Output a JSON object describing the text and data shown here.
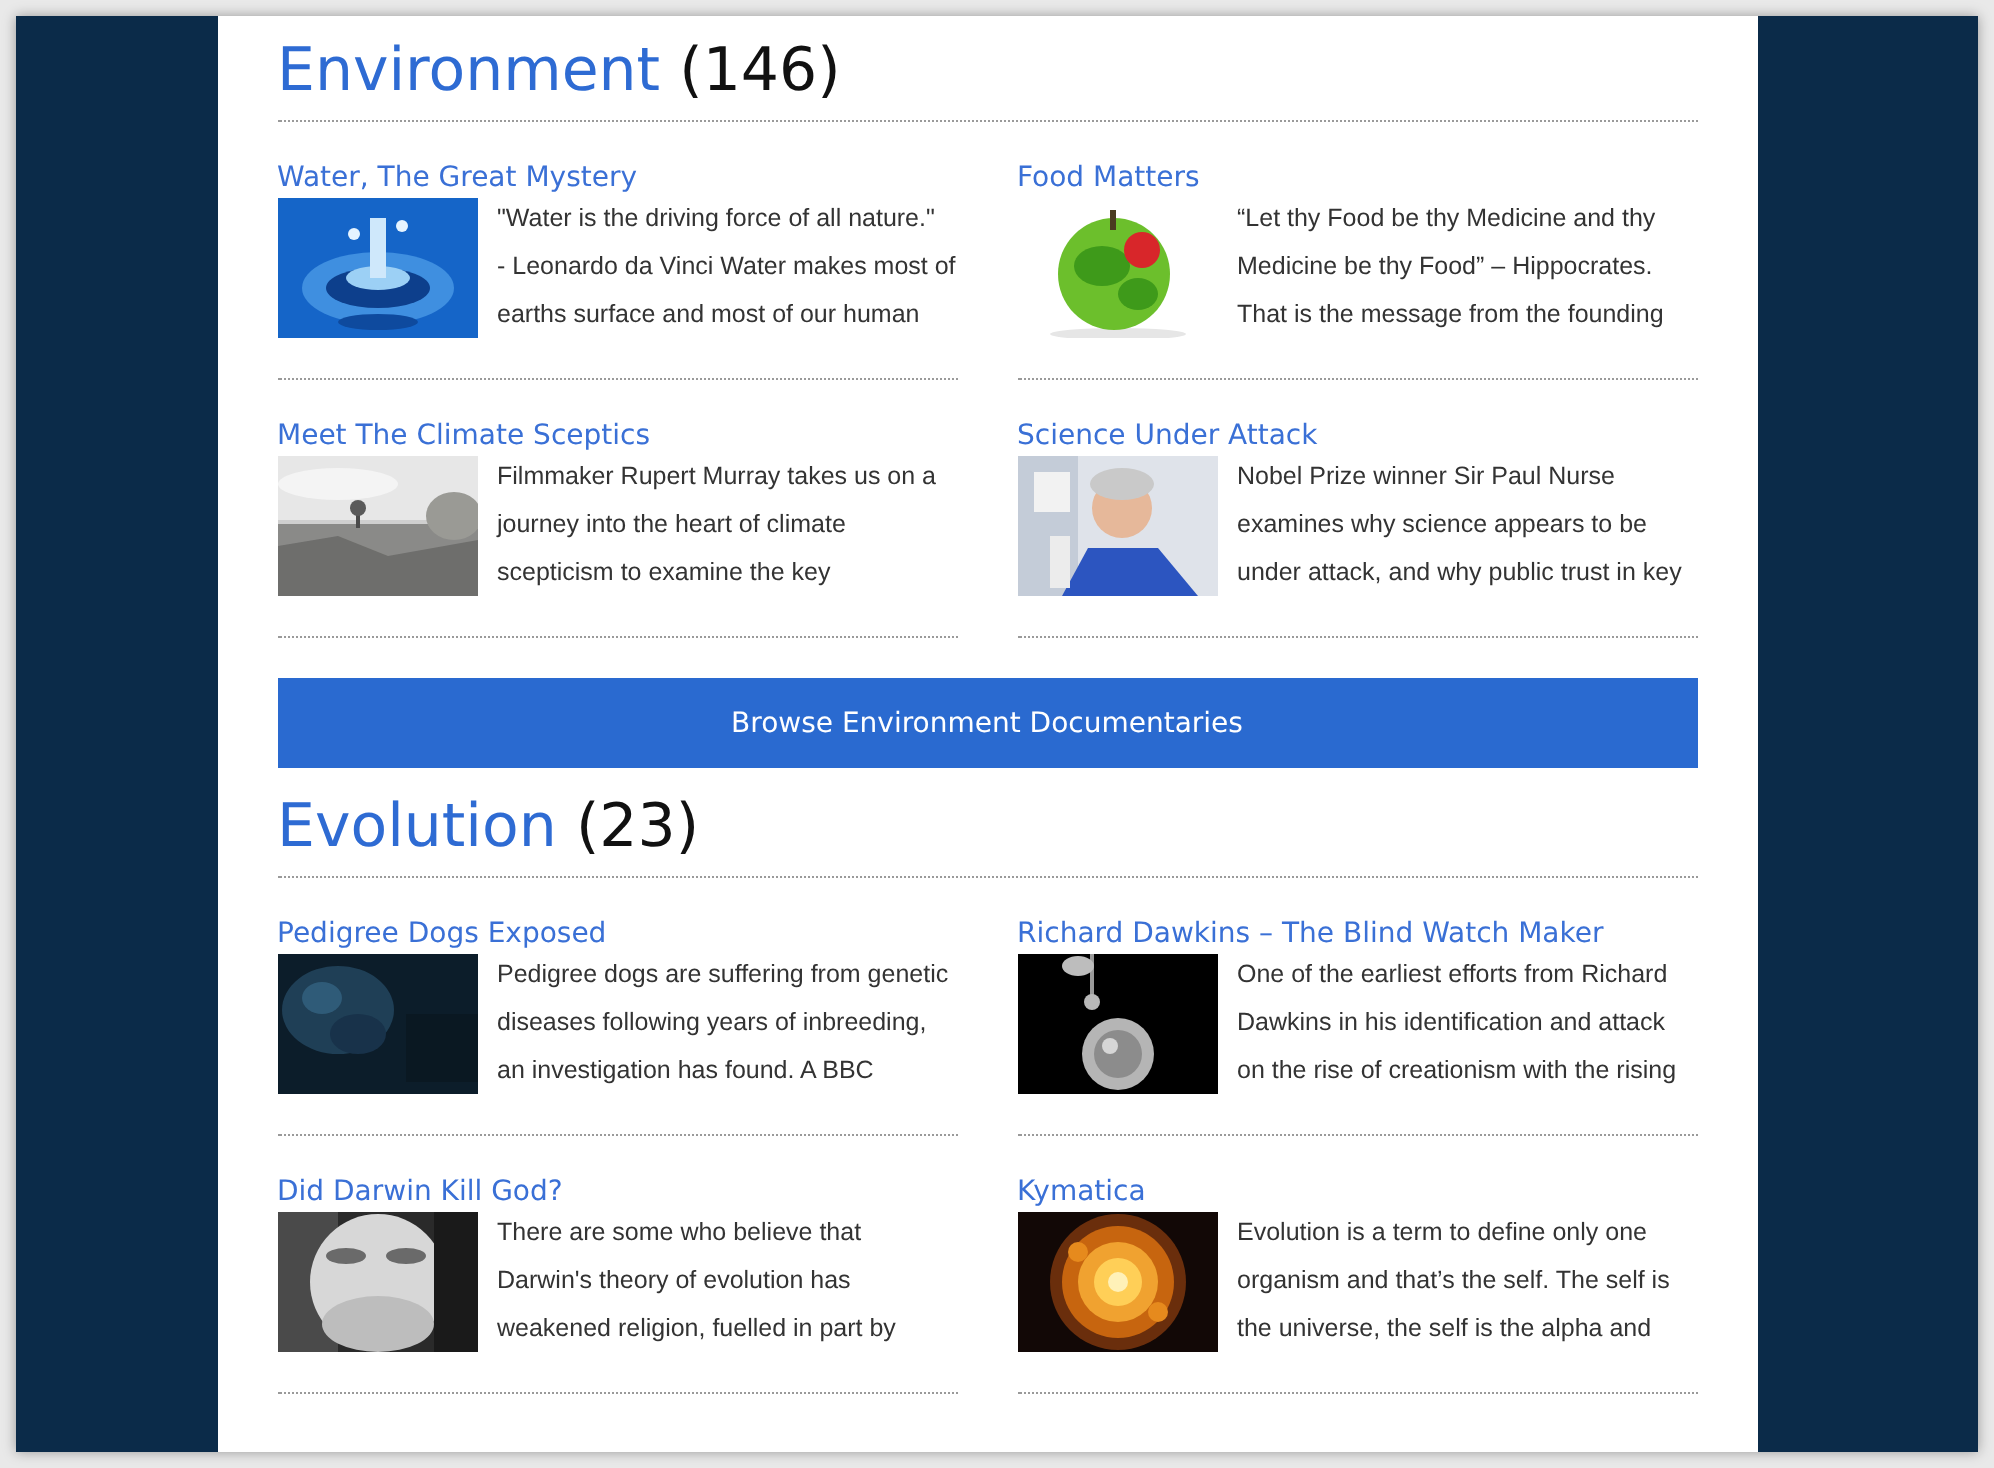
{
  "sections": [
    {
      "heading": "Environment",
      "count": "(146)",
      "items": [
        {
          "title": "Water, The Great Mystery",
          "lines": [
            "\"Water is the driving force of all nature.\"",
            "- Leonardo da Vinci Water makes most of",
            "earths surface and most of our human"
          ],
          "image": {
            "kind": "picture"
          }
        },
        {
          "title": "Food Matters",
          "lines": [
            "“Let thy Food be thy Medicine and thy",
            "Medicine be thy Food” – Hippocrates.",
            "That is the message from the founding"
          ],
          "image": {
            "kind": "picture"
          }
        },
        {
          "title": "Meet The Climate Sceptics",
          "lines": [
            "Filmmaker Rupert Murray takes us on a",
            "journey into the heart of climate",
            "scepticism to examine the key"
          ],
          "image": {
            "kind": "picture"
          }
        },
        {
          "title": "Science Under Attack",
          "lines": [
            "Nobel Prize winner Sir Paul Nurse",
            "examines why science appears to be",
            "under attack, and why public trust in key"
          ],
          "image": {
            "kind": "picture"
          }
        }
      ],
      "button": "Browse Environment Documentaries"
    },
    {
      "heading": "Evolution",
      "count": "(23)",
      "items": [
        {
          "title": "Pedigree Dogs Exposed",
          "lines": [
            "Pedigree dogs are suffering from genetic",
            "diseases following years of inbreeding,",
            "an investigation has found. A BBC"
          ],
          "image": {
            "kind": "picture"
          }
        },
        {
          "title": "Richard Dawkins – The Blind Watch Maker",
          "lines": [
            "One of the earliest efforts from Richard",
            "Dawkins in his identification and attack",
            "on the rise of creationism with the rising"
          ],
          "image": {
            "kind": "picture"
          }
        },
        {
          "title": "Did Darwin Kill God?",
          "lines": [
            "There are some who believe that",
            "Darwin's theory of evolution has",
            "weakened religion, fuelled in part by"
          ],
          "image": {
            "kind": "picture"
          }
        },
        {
          "title": "Kymatica",
          "lines": [
            "Evolution is a term to define only one",
            "organism and that’s the self. The self is",
            "the universe, the self is the alpha and"
          ],
          "image": {
            "kind": "picture"
          }
        }
      ]
    }
  ]
}
